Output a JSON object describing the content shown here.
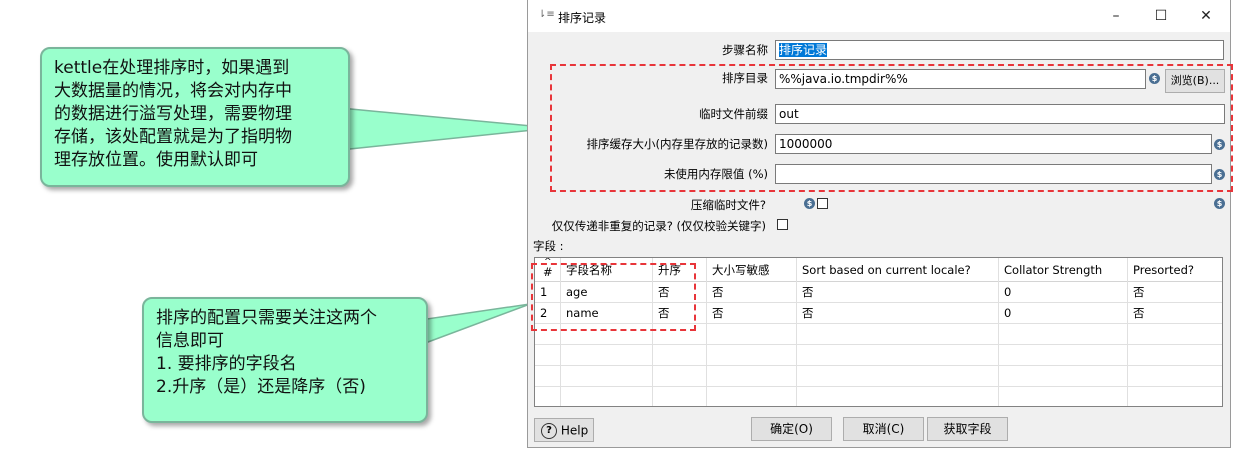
{
  "window": {
    "title": "排序记录",
    "minimize": "–",
    "maximize": "☐",
    "close": "✕"
  },
  "form": {
    "step_name_label": "步骤名称",
    "step_name_value": "排序记录",
    "sort_dir_label": "排序目录",
    "sort_dir_value": "%%java.io.tmpdir%%",
    "browse_button": "浏览(B)...",
    "temp_prefix_label": "临时文件前缀",
    "temp_prefix_value": "out",
    "cache_size_label": "排序缓存大小(内存里存放的记录数)",
    "cache_size_value": "1000000",
    "free_mem_label": "未使用内存限值 (%)",
    "free_mem_value": "",
    "compress_label": "压缩临时文件?",
    "unique_label": "仅仅传递非重复的记录? (仅仅校验关键字)",
    "fields_label": "字段 :"
  },
  "table": {
    "headers": [
      "#",
      "字段名称",
      "升序",
      "大小写敏感",
      "Sort based on current locale?",
      "Collator Strength",
      "Presorted?"
    ],
    "sort_indicator": "^",
    "rows": [
      [
        "1",
        "age",
        "否",
        "否",
        "否",
        "0",
        "否"
      ],
      [
        "2",
        "name",
        "否",
        "否",
        "否",
        "0",
        "否"
      ]
    ]
  },
  "buttons": {
    "help": "Help",
    "ok": "确定(O)",
    "cancel": "取消(C)",
    "get_fields": "获取字段"
  },
  "callouts": {
    "top": [
      "kettle在处理排序时，如果遇到",
      "大数据量的情况，将会对内存中",
      "的数据进行溢写处理，需要物理",
      "存储，该处配置就是为了指明物",
      "理存放位置。使用默认即可"
    ],
    "bottom": [
      "排序的配置只需要关注这两个",
      "信息即可",
      "1. 要排序的字段名",
      "2.升序（是）还是降序（否)"
    ]
  },
  "colors": {
    "callout_fill": "#99ffcc",
    "callout_border": "#7ab59b",
    "highlight_dash": "#e8353a",
    "selection": "#0078d7"
  }
}
